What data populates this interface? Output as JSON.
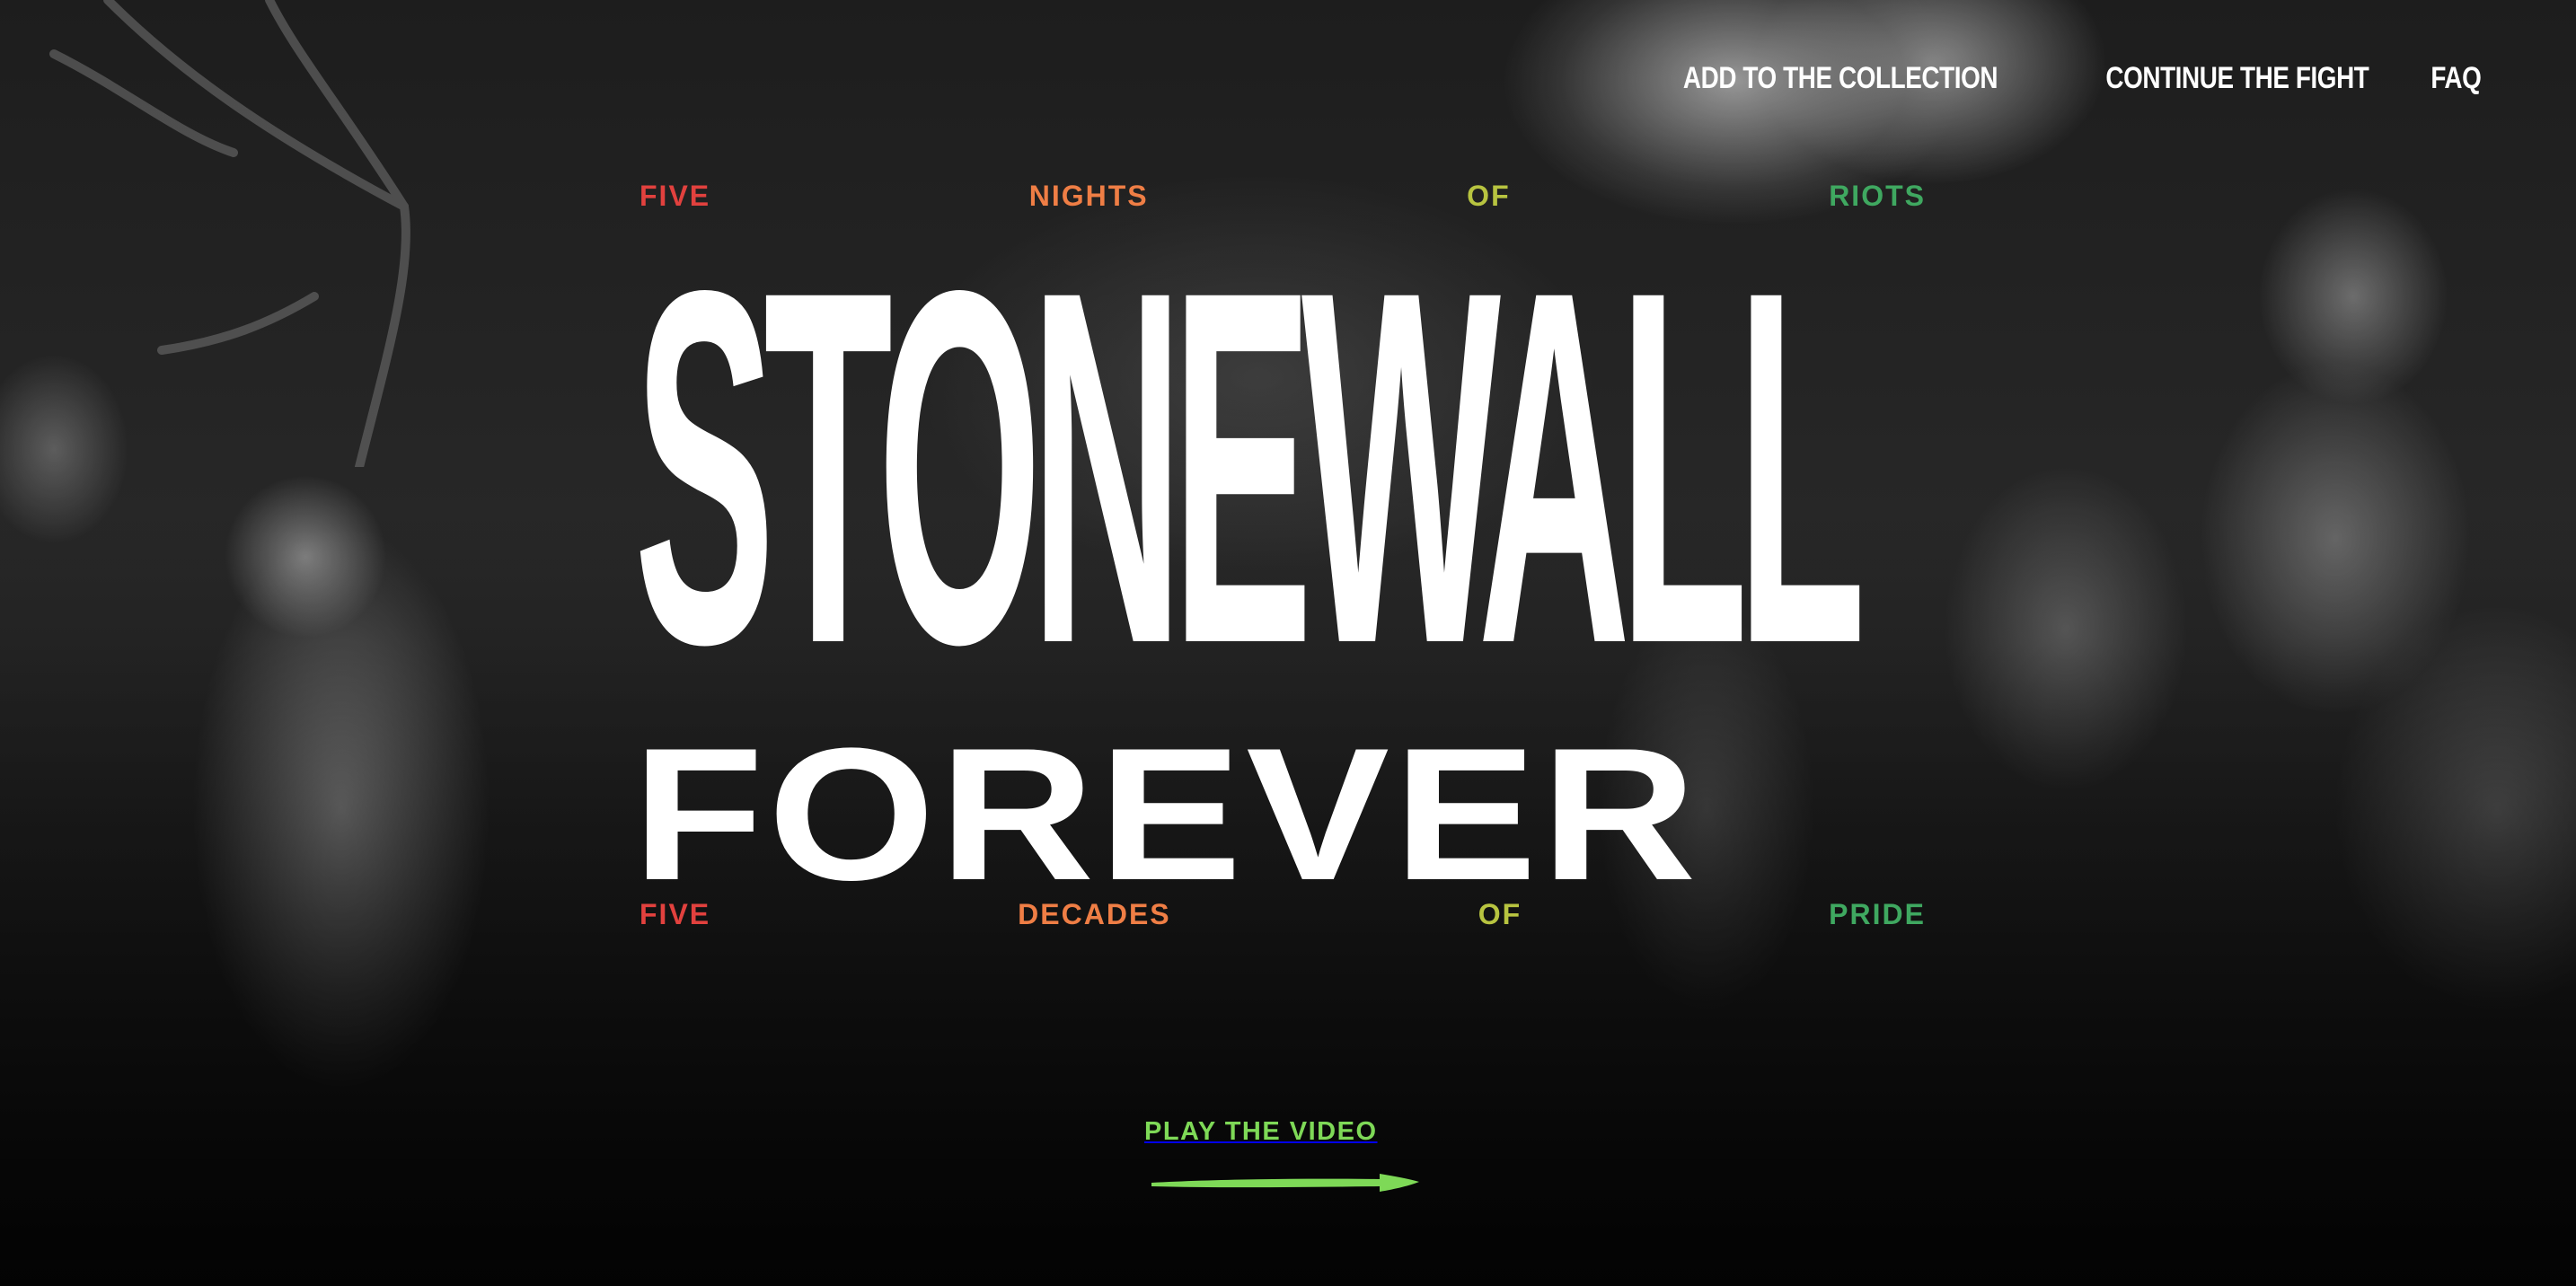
{
  "nav": {
    "items": [
      {
        "label": "ADD TO THE COLLECTION"
      },
      {
        "label": "CONTINUE THE FIGHT"
      },
      {
        "label": "FAQ"
      }
    ]
  },
  "hero": {
    "top_tagline": [
      "FIVE",
      "NIGHTS",
      "OF",
      "RIOTS"
    ],
    "title": "STONEWALL",
    "subtitle": "FOREVER",
    "bottom_tagline": [
      "FIVE",
      "DECADES",
      "OF",
      "PRIDE"
    ]
  },
  "cta": {
    "label": "PLAY THE VIDEO",
    "arrow_icon": "arrow-right-icon"
  },
  "colors": {
    "red": "#e2413e",
    "orange": "#ef7e45",
    "olive": "#b8c440",
    "green": "#3fa860",
    "cta_green": "#7ed957",
    "text": "#ffffff"
  }
}
